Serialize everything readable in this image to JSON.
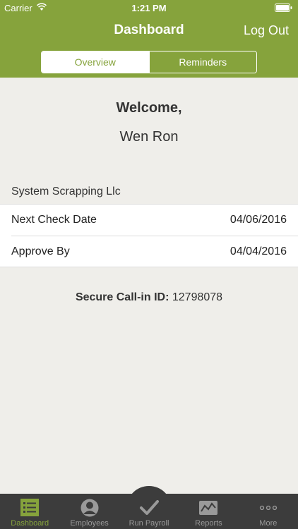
{
  "status_bar": {
    "carrier": "Carrier",
    "time": "1:21 PM"
  },
  "nav": {
    "title": "Dashboard",
    "logout_label": "Log Out"
  },
  "segments": {
    "overview": "Overview",
    "reminders": "Reminders"
  },
  "welcome": {
    "greeting": "Welcome,",
    "name": "Wen Ron"
  },
  "company": "System Scrapping Llc",
  "rows": [
    {
      "label": "Next Check Date",
      "value": "04/06/2016"
    },
    {
      "label": "Approve By",
      "value": "04/04/2016"
    }
  ],
  "callin": {
    "label": "Secure Call-in ID:",
    "value": "12798078"
  },
  "tabs": [
    {
      "label": "Dashboard",
      "icon": "list-icon"
    },
    {
      "label": "Employees",
      "icon": "person-icon"
    },
    {
      "label": "Run Payroll",
      "icon": "checkmark-icon"
    },
    {
      "label": "Reports",
      "icon": "chart-icon"
    },
    {
      "label": "More",
      "icon": "more-icon"
    }
  ],
  "colors": {
    "brand": "#86a33c",
    "tabbar": "#3c3c3c",
    "background": "#efeeea"
  }
}
